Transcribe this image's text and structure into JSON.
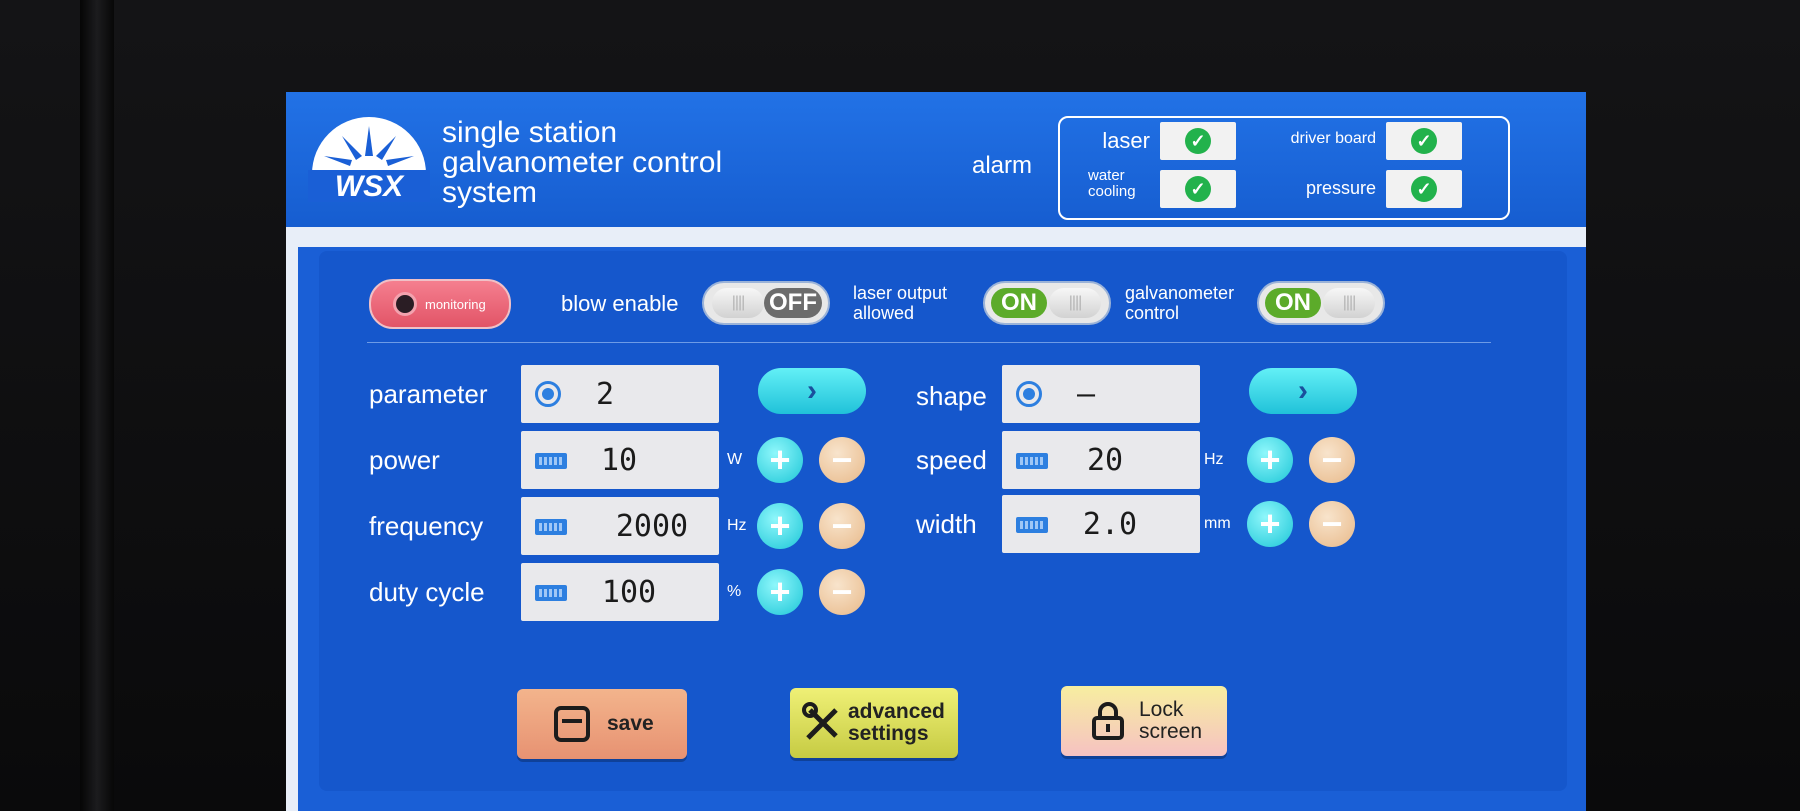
{
  "header": {
    "logo_text": "WSX",
    "title_lines": [
      "single station",
      "galvanometer control",
      "system"
    ],
    "alarm_label": "alarm",
    "alarm_items": [
      {
        "label": "laser",
        "status": "ok"
      },
      {
        "label": "driver board",
        "status": "ok"
      },
      {
        "label_lines": [
          "water",
          "cooling"
        ],
        "status": "ok"
      },
      {
        "label": "pressure",
        "status": "ok"
      }
    ]
  },
  "toolbar": {
    "monitoring_label": "monitoring",
    "blow_enable": {
      "label": "blow enable",
      "state": "OFF"
    },
    "laser_output": {
      "label_lines": [
        "laser output",
        "allowed"
      ],
      "state": "ON"
    },
    "galvanometer_control": {
      "label_lines": [
        "galvanometer",
        "control"
      ],
      "state": "ON"
    }
  },
  "params": {
    "parameter": {
      "label": "parameter",
      "value": "2"
    },
    "power": {
      "label": "power",
      "value": "10",
      "unit": "W"
    },
    "frequency": {
      "label": "frequency",
      "value": "2000",
      "unit": "Hz"
    },
    "duty_cycle": {
      "label": "duty cycle",
      "value": "100",
      "unit": "%"
    },
    "shape": {
      "label": "shape",
      "value": "—"
    },
    "speed": {
      "label": "speed",
      "value": "20",
      "unit": "Hz"
    },
    "width": {
      "label": "width",
      "value": "2.0",
      "unit": "mm"
    }
  },
  "actions": {
    "save_label": "save",
    "advanced_lines": [
      "advanced",
      "settings"
    ],
    "lock_lines": [
      "Lock",
      "screen"
    ]
  },
  "colors": {
    "screen_blue": "#1a5fd6",
    "panel_blue": "#1557cc",
    "ok_green": "#22b24c",
    "toggle_on": "#5cab2a",
    "toggle_off": "#6c6c6c",
    "plus_cyan": "#1cc6d7",
    "minus_tan": "#e8b989"
  },
  "icons": {
    "alarm_ok": "check-circle-icon",
    "monitoring": "record-icon",
    "field_input": "keyboard-icon",
    "selector": "radio-icon",
    "next": "chevron-right-icon",
    "increment": "plus-icon",
    "decrement": "minus-icon",
    "save": "floppy-disk-icon",
    "advanced": "wrench-screwdriver-icon",
    "lock": "padlock-icon"
  }
}
